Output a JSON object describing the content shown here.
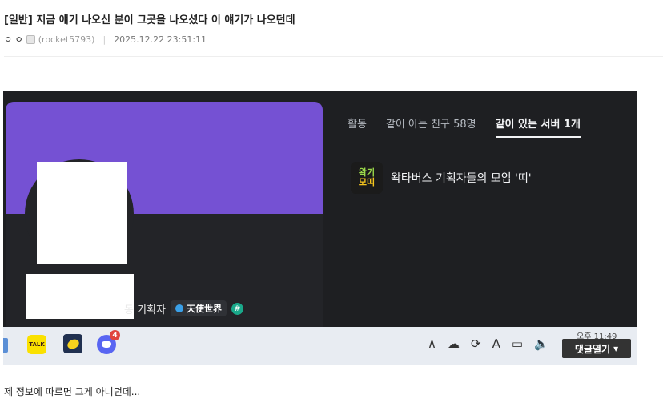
{
  "post": {
    "title": "[일반] 지금 얘기 나오신 분이 그곳을 나오셨다 이 얘기가 나오던데",
    "author_nick": "ㅇ ㅇ",
    "author_ip": "(rocket5793)",
    "datetime": "2025.12.22 23:51:11",
    "body_text": "제 정보에 따르면 그게 아니던데..."
  },
  "screenshot": {
    "profile": {
      "role_label": "동 기획자",
      "server_tag": "天使世界",
      "hash_symbol": "#"
    },
    "tabs": [
      {
        "label": "활동",
        "active": false
      },
      {
        "label": "같이 아는 친구 58명",
        "active": false
      },
      {
        "label": "같이 있는 서버 1개",
        "active": true
      }
    ],
    "mutual_server": {
      "name": "왁타버스 기획자들의 모임 '띠'",
      "logo_top": "왁기",
      "logo_bottom": "모띠"
    },
    "taskbar": {
      "kakao_label": "TALK",
      "discord_badge": "4",
      "tray_icons": [
        "chevron-up-icon",
        "cloud-off-icon",
        "sync-icon",
        "ime-a-icon",
        "monitor-icon",
        "speaker-icon"
      ],
      "tray_ime": "A",
      "clock": "오후 11:49"
    }
  },
  "comment_button": {
    "label": "댓글열기",
    "icon": "caret-down-icon"
  },
  "colors": {
    "banner": "#7551d3",
    "discord_dark": "#1e1f22",
    "button": "#333333"
  }
}
